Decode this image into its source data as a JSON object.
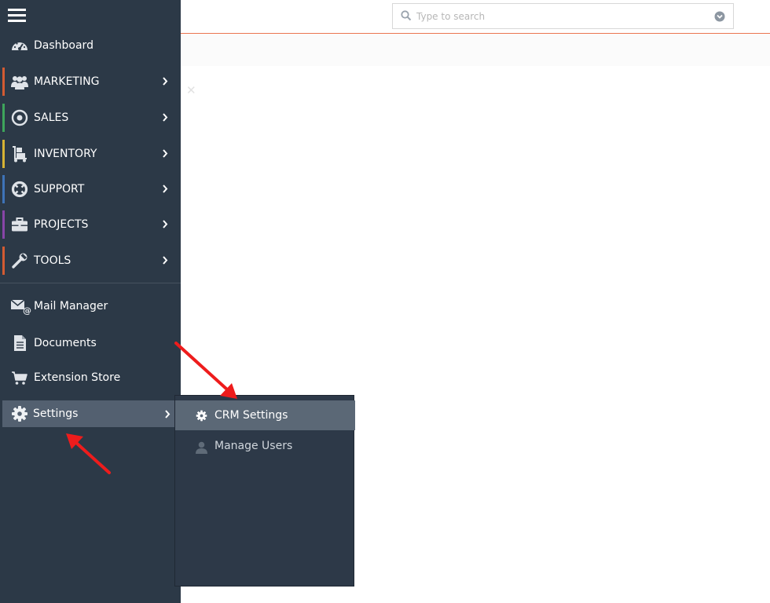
{
  "search": {
    "placeholder": "Type to search"
  },
  "sidebar": {
    "items": [
      {
        "label": "Dashboard"
      },
      {
        "label": "MARKETING",
        "accent": "#d35b32"
      },
      {
        "label": "SALES",
        "accent": "#3ea55b"
      },
      {
        "label": "INVENTORY",
        "accent": "#d7b334"
      },
      {
        "label": "SUPPORT",
        "accent": "#3e73b8"
      },
      {
        "label": "PROJECTS",
        "accent": "#8845a8"
      },
      {
        "label": "TOOLS",
        "accent": "#d35b32"
      }
    ],
    "extras": [
      {
        "label": "Mail Manager"
      },
      {
        "label": "Documents"
      },
      {
        "label": "Extension Store"
      }
    ],
    "settings": {
      "label": "Settings"
    }
  },
  "flyout": {
    "items": [
      {
        "label": "CRM Settings"
      },
      {
        "label": "Manage Users"
      }
    ]
  },
  "colors": {
    "sidebar_bg": "#2c3947",
    "header_border": "#e9744f",
    "arrow": "#ee1c1c"
  },
  "icons": {
    "dashboard": "speedometer-icon",
    "marketing": "users-group-icon",
    "sales": "target-icon",
    "inventory": "hand-truck-icon",
    "support": "lifebuoy-icon",
    "projects": "briefcase-icon",
    "tools": "wrench-icon",
    "mail": "mail-at-icon",
    "documents": "document-icon",
    "store": "cart-icon",
    "settings": "gear-icon",
    "crm_settings": "gear-icon",
    "manage_users": "user-icon"
  }
}
